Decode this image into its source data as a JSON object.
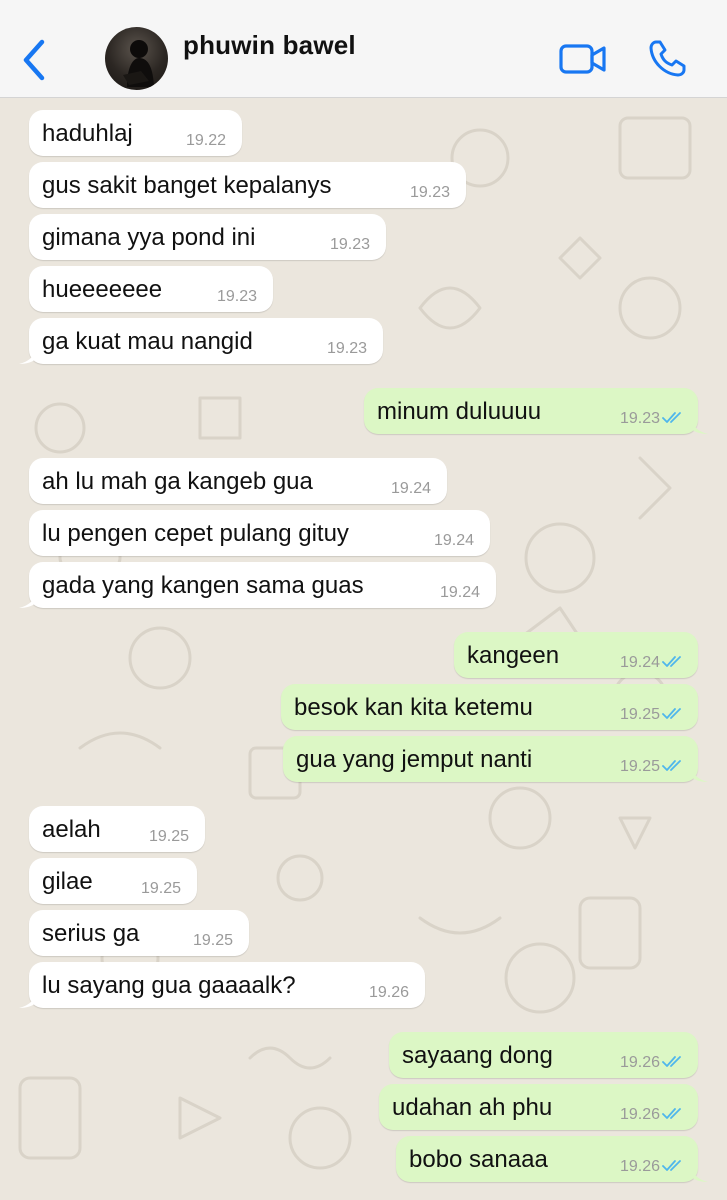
{
  "header": {
    "contact_name": "phuwin bawel"
  },
  "colors": {
    "accent": "#1877f2",
    "outgoing_bubble": "#dcf7c5",
    "incoming_bubble": "#ffffff",
    "read_ticks": "#4fb6ec"
  },
  "messages": [
    {
      "dir": "in",
      "text": "haduhlaj",
      "time": "19.22"
    },
    {
      "dir": "in",
      "text": "gus sakit banget kepalanys",
      "time": "19.23"
    },
    {
      "dir": "in",
      "text": "gimana yya pond ini",
      "time": "19.23"
    },
    {
      "dir": "in",
      "text": "hueeeeeee",
      "time": "19.23"
    },
    {
      "dir": "in",
      "text": "ga kuat mau nangid",
      "time": "19.23"
    },
    {
      "dir": "out",
      "text": "minum duluuuu",
      "time": "19.23"
    },
    {
      "dir": "in",
      "text": "ah lu mah ga kangeb gua",
      "time": "19.24"
    },
    {
      "dir": "in",
      "text": "lu pengen cepet pulang gituy",
      "time": "19.24"
    },
    {
      "dir": "in",
      "text": "gada yang kangen sama guas",
      "time": "19.24"
    },
    {
      "dir": "out",
      "text": "kangeen",
      "time": "19.24"
    },
    {
      "dir": "out",
      "text": "besok kan kita ketemu",
      "time": "19.25"
    },
    {
      "dir": "out",
      "text": "gua yang jemput nanti",
      "time": "19.25"
    },
    {
      "dir": "in",
      "text": "aelah",
      "time": "19.25"
    },
    {
      "dir": "in",
      "text": "gilae",
      "time": "19.25"
    },
    {
      "dir": "in",
      "text": "serius ga",
      "time": "19.25"
    },
    {
      "dir": "in",
      "text": "lu sayang gua gaaaalk?",
      "time": "19.26"
    },
    {
      "dir": "out",
      "text": "sayaang dong",
      "time": "19.26"
    },
    {
      "dir": "out",
      "text": "udahan ah phu",
      "time": "19.26"
    },
    {
      "dir": "out",
      "text": "bobo sanaaa",
      "time": "19.26"
    }
  ]
}
